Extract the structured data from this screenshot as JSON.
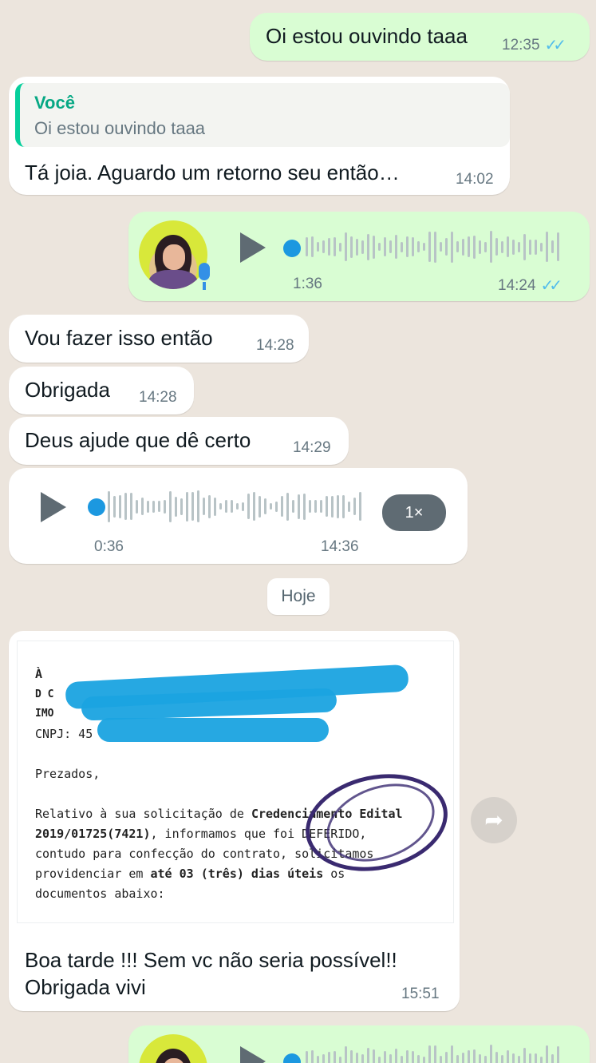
{
  "messages": {
    "m1": {
      "text": "Oi estou ouvindo taaa",
      "time": "12:35"
    },
    "m2": {
      "quote_author": "Você",
      "quote_text": "Oi estou ouvindo taaa",
      "text": "Tá joia. Aguardo um retorno seu então…",
      "time": "14:02"
    },
    "m3": {
      "duration": "1:36",
      "time": "14:24",
      "progress": 0
    },
    "m4": {
      "text": "Vou fazer isso então",
      "time": "14:28"
    },
    "m5": {
      "text": "Obrigada",
      "time": "14:28"
    },
    "m6": {
      "text": "Deus ajude que dê certo",
      "time": "14:29"
    },
    "m7": {
      "duration": "0:36",
      "time": "14:36",
      "speed": "1×",
      "progress": 0
    },
    "date_separator": "Hoje",
    "m8": {
      "doc_lines": {
        "l1": "À",
        "l2": "D C",
        "l3": "IMO",
        "l4": "CNPJ: 45",
        "l5": "Prezados,",
        "l6a": "Relativo à sua solicitação de ",
        "l6b": "Credenciamento Edital",
        "l7a": "2019/01725(7421)",
        "l7b": ", informamos que foi DEFERIDO,",
        "l8": "contudo para confecção do contrato, solicitamos",
        "l9a": "providenciar em ",
        "l9b": "até 03 (três) dias úteis",
        "l9c": " os",
        "l10": "documentos abaixo:"
      },
      "text_line1": "Boa tarde !!! Sem vc não seria possível!!",
      "text_line2": "Obrigada vivi",
      "time": "15:51"
    }
  },
  "icons": {
    "read": "double-check-icon",
    "play": "play-icon",
    "forward": "forward-icon",
    "mic": "mic-icon"
  },
  "colors": {
    "outgoing": "#d9fdd3",
    "incoming": "#ffffff",
    "background": "#ece5dd",
    "accent": "#06cf9c",
    "ticks": "#53bdeb"
  }
}
